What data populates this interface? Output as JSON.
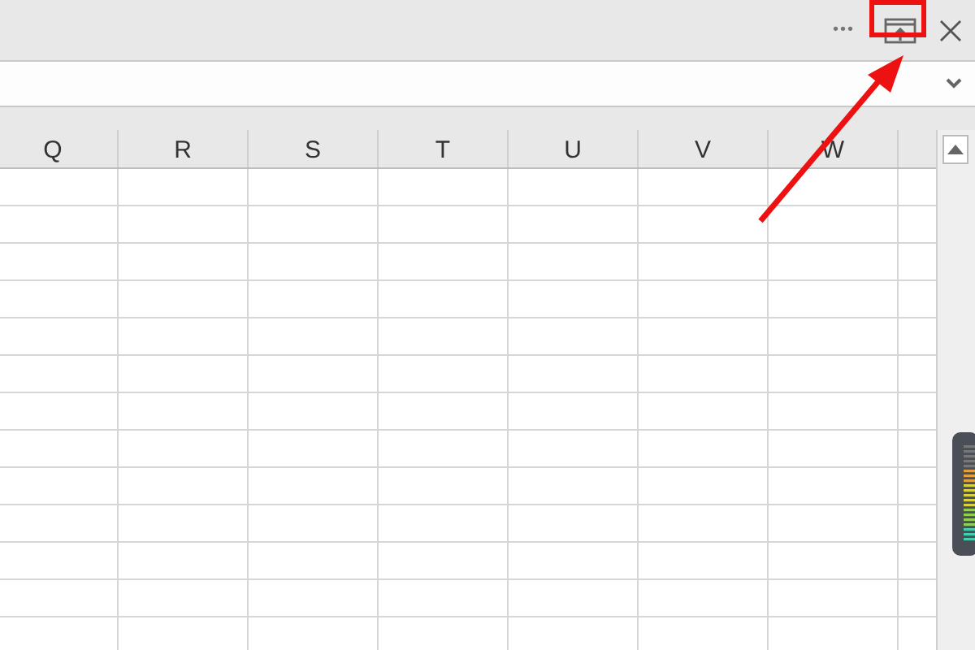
{
  "toolbar": {
    "more": "•••"
  },
  "columns": [
    {
      "label": "Q"
    },
    {
      "label": "R"
    },
    {
      "label": "S"
    },
    {
      "label": "T"
    },
    {
      "label": "U"
    },
    {
      "label": "V"
    },
    {
      "label": "W"
    }
  ]
}
